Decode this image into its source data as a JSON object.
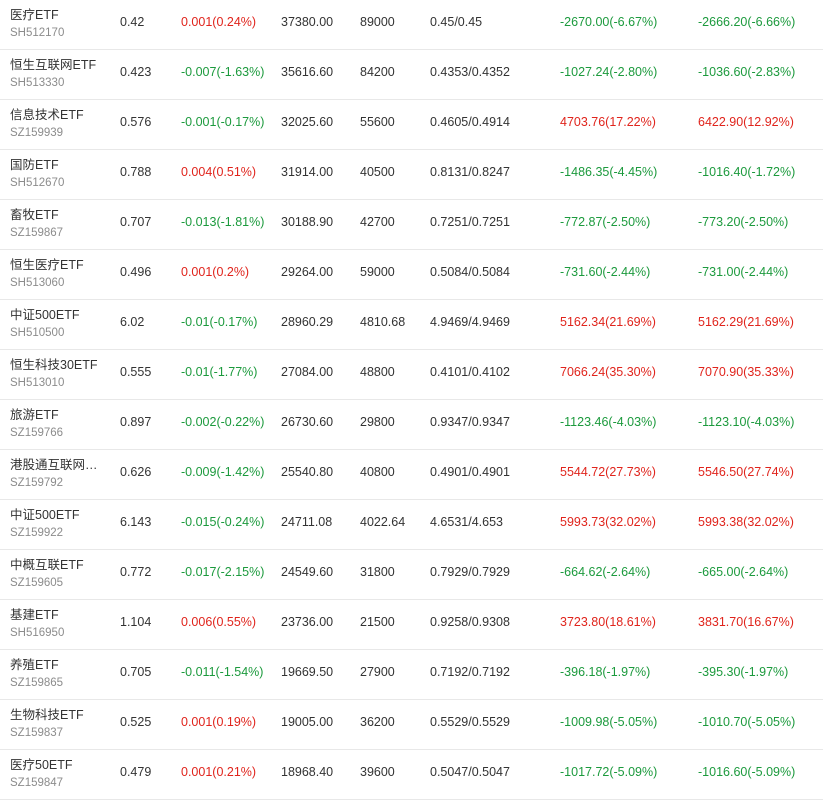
{
  "colors": {
    "up": "#e0241c",
    "down": "#1c9a3d",
    "text": "#333333",
    "code": "#8c8c8c"
  },
  "rows": [
    {
      "name": "医疗ETF",
      "code": "SH512170",
      "price": "0.42",
      "change": "0.001(0.24%)",
      "change_dir": "up",
      "amount": "37380.00",
      "volume": "89000",
      "bid_ask": "0.45/0.45",
      "pl1": "-2670.00(-6.67%)",
      "pl1_dir": "down",
      "pl2": "-2666.20(-6.66%)",
      "pl2_dir": "down"
    },
    {
      "name": "恒生互联网ETF",
      "code": "SH513330",
      "price": "0.423",
      "change": "-0.007(-1.63%)",
      "change_dir": "down",
      "amount": "35616.60",
      "volume": "84200",
      "bid_ask": "0.4353/0.4352",
      "pl1": "-1027.24(-2.80%)",
      "pl1_dir": "down",
      "pl2": "-1036.60(-2.83%)",
      "pl2_dir": "down"
    },
    {
      "name": "信息技术ETF",
      "code": "SZ159939",
      "price": "0.576",
      "change": "-0.001(-0.17%)",
      "change_dir": "down",
      "amount": "32025.60",
      "volume": "55600",
      "bid_ask": "0.4605/0.4914",
      "pl1": "4703.76(17.22%)",
      "pl1_dir": "up",
      "pl2": "6422.90(12.92%)",
      "pl2_dir": "up"
    },
    {
      "name": "国防ETF",
      "code": "SH512670",
      "price": "0.788",
      "change": "0.004(0.51%)",
      "change_dir": "up",
      "amount": "31914.00",
      "volume": "40500",
      "bid_ask": "0.8131/0.8247",
      "pl1": "-1486.35(-4.45%)",
      "pl1_dir": "down",
      "pl2": "-1016.40(-1.72%)",
      "pl2_dir": "down"
    },
    {
      "name": "畜牧ETF",
      "code": "SZ159867",
      "price": "0.707",
      "change": "-0.013(-1.81%)",
      "change_dir": "down",
      "amount": "30188.90",
      "volume": "42700",
      "bid_ask": "0.7251/0.7251",
      "pl1": "-772.87(-2.50%)",
      "pl1_dir": "down",
      "pl2": "-773.20(-2.50%)",
      "pl2_dir": "down"
    },
    {
      "name": "恒生医疗ETF",
      "code": "SH513060",
      "price": "0.496",
      "change": "0.001(0.2%)",
      "change_dir": "up",
      "amount": "29264.00",
      "volume": "59000",
      "bid_ask": "0.5084/0.5084",
      "pl1": "-731.60(-2.44%)",
      "pl1_dir": "down",
      "pl2": "-731.00(-2.44%)",
      "pl2_dir": "down"
    },
    {
      "name": "中证500ETF",
      "code": "SH510500",
      "price": "6.02",
      "change": "-0.01(-0.17%)",
      "change_dir": "down",
      "amount": "28960.29",
      "volume": "4810.68",
      "bid_ask": "4.9469/4.9469",
      "pl1": "5162.34(21.69%)",
      "pl1_dir": "up",
      "pl2": "5162.29(21.69%)",
      "pl2_dir": "up"
    },
    {
      "name": "恒生科技30ETF",
      "code": "SH513010",
      "price": "0.555",
      "change": "-0.01(-1.77%)",
      "change_dir": "down",
      "amount": "27084.00",
      "volume": "48800",
      "bid_ask": "0.4101/0.4102",
      "pl1": "7066.24(35.30%)",
      "pl1_dir": "up",
      "pl2": "7070.90(35.33%)",
      "pl2_dir": "up"
    },
    {
      "name": "旅游ETF",
      "code": "SZ159766",
      "price": "0.897",
      "change": "-0.002(-0.22%)",
      "change_dir": "down",
      "amount": "26730.60",
      "volume": "29800",
      "bid_ask": "0.9347/0.9347",
      "pl1": "-1123.46(-4.03%)",
      "pl1_dir": "down",
      "pl2": "-1123.10(-4.03%)",
      "pl2_dir": "down"
    },
    {
      "name": "港股通互联网…",
      "code": "SZ159792",
      "price": "0.626",
      "change": "-0.009(-1.42%)",
      "change_dir": "down",
      "amount": "25540.80",
      "volume": "40800",
      "bid_ask": "0.4901/0.4901",
      "pl1": "5544.72(27.73%)",
      "pl1_dir": "up",
      "pl2": "5546.50(27.74%)",
      "pl2_dir": "up"
    },
    {
      "name": "中证500ETF",
      "code": "SZ159922",
      "price": "6.143",
      "change": "-0.015(-0.24%)",
      "change_dir": "down",
      "amount": "24711.08",
      "volume": "4022.64",
      "bid_ask": "4.6531/4.653",
      "pl1": "5993.73(32.02%)",
      "pl1_dir": "up",
      "pl2": "5993.38(32.02%)",
      "pl2_dir": "up"
    },
    {
      "name": "中概互联ETF",
      "code": "SZ159605",
      "price": "0.772",
      "change": "-0.017(-2.15%)",
      "change_dir": "down",
      "amount": "24549.60",
      "volume": "31800",
      "bid_ask": "0.7929/0.7929",
      "pl1": "-664.62(-2.64%)",
      "pl1_dir": "down",
      "pl2": "-665.00(-2.64%)",
      "pl2_dir": "down"
    },
    {
      "name": "基建ETF",
      "code": "SH516950",
      "price": "1.104",
      "change": "0.006(0.55%)",
      "change_dir": "up",
      "amount": "23736.00",
      "volume": "21500",
      "bid_ask": "0.9258/0.9308",
      "pl1": "3723.80(18.61%)",
      "pl1_dir": "up",
      "pl2": "3831.70(16.67%)",
      "pl2_dir": "up"
    },
    {
      "name": "养殖ETF",
      "code": "SZ159865",
      "price": "0.705",
      "change": "-0.011(-1.54%)",
      "change_dir": "down",
      "amount": "19669.50",
      "volume": "27900",
      "bid_ask": "0.7192/0.7192",
      "pl1": "-396.18(-1.97%)",
      "pl1_dir": "down",
      "pl2": "-395.30(-1.97%)",
      "pl2_dir": "down"
    },
    {
      "name": "生物科技ETF",
      "code": "SZ159837",
      "price": "0.525",
      "change": "0.001(0.19%)",
      "change_dir": "up",
      "amount": "19005.00",
      "volume": "36200",
      "bid_ask": "0.5529/0.5529",
      "pl1": "-1009.98(-5.05%)",
      "pl1_dir": "down",
      "pl2": "-1010.70(-5.05%)",
      "pl2_dir": "down"
    },
    {
      "name": "医疗50ETF",
      "code": "SZ159847",
      "price": "0.479",
      "change": "0.001(0.21%)",
      "change_dir": "up",
      "amount": "18968.40",
      "volume": "39600",
      "bid_ask": "0.5047/0.5047",
      "pl1": "-1017.72(-5.09%)",
      "pl1_dir": "down",
      "pl2": "-1016.60(-5.09%)",
      "pl2_dir": "down"
    }
  ]
}
